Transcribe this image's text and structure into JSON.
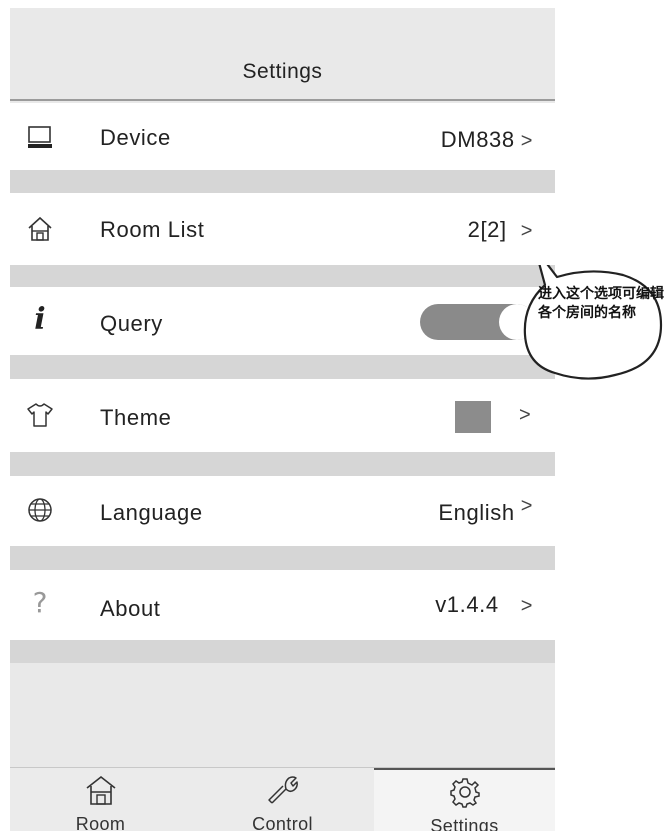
{
  "header": {
    "title": "Settings"
  },
  "rows": [
    {
      "icon": "monitor-icon",
      "label": "Device",
      "value": "DM838",
      "chevron": ">"
    },
    {
      "icon": "home-icon",
      "label": "Room List",
      "value": "2[2]",
      "chevron": ">"
    },
    {
      "icon": "info-icon",
      "label": "Query",
      "toggle": true
    },
    {
      "icon": "shirt-icon",
      "label": "Theme",
      "swatch_color": "#8c8c8c",
      "chevron": ">"
    },
    {
      "icon": "globe-icon",
      "label": "Language",
      "value": "English",
      "chevron": ">"
    },
    {
      "icon": "question-icon",
      "label": "About",
      "value": "v1.4.4",
      "chevron": ">"
    }
  ],
  "info_glyph": "i",
  "help_glyph": "?",
  "callout": {
    "text": "进入这个选项可编辑各个房间的名称"
  },
  "tabbar": {
    "tabs": [
      {
        "icon": "home-icon",
        "label": "Room"
      },
      {
        "icon": "wrench-icon",
        "label": "Control"
      },
      {
        "icon": "gear-icon",
        "label": "Settings",
        "active": true
      }
    ]
  }
}
